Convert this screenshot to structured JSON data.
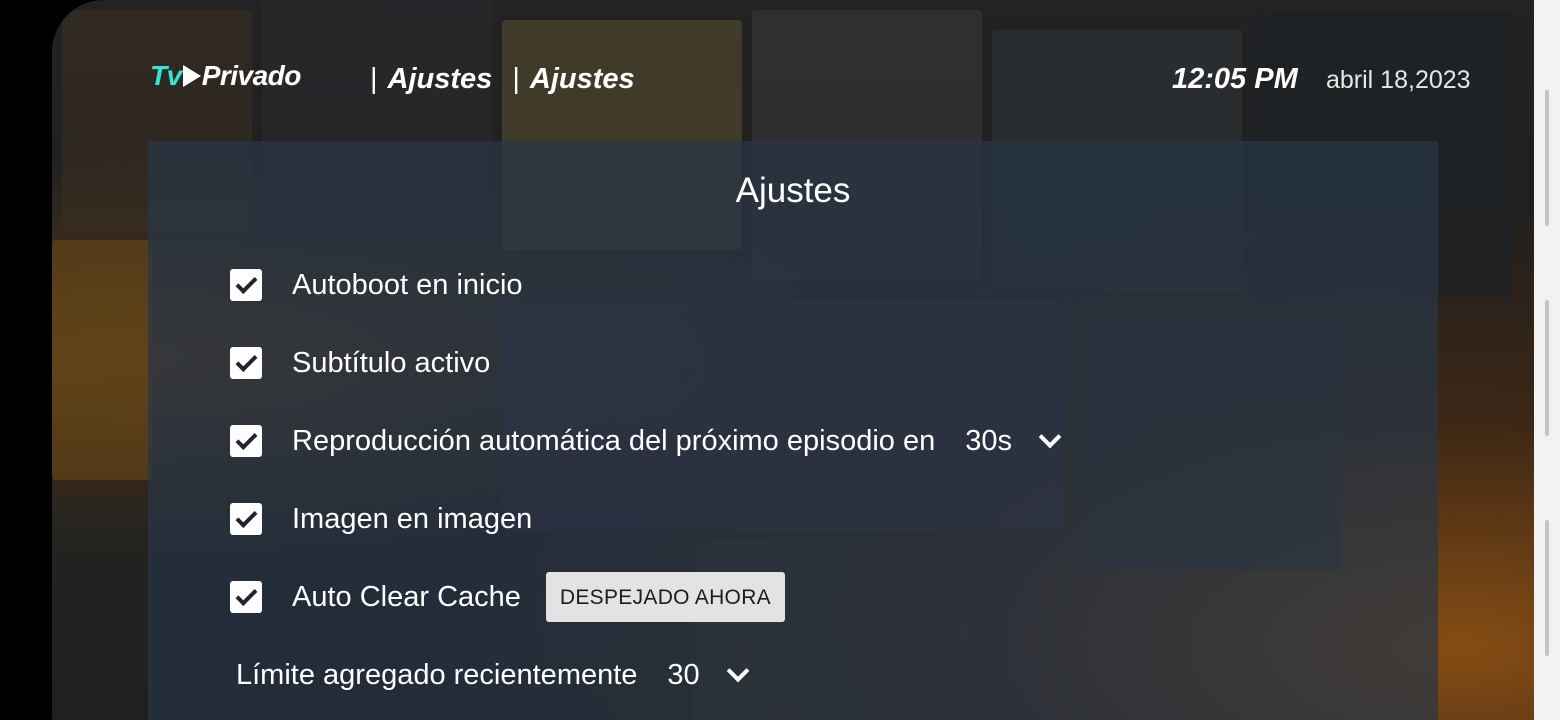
{
  "header": {
    "logo_tv": "Tv",
    "logo_privado": "Privado",
    "crumb_1": "Ajustes",
    "crumb_2": "Ajustes",
    "time": "12:05 PM",
    "date": "abril 18,2023"
  },
  "panel": {
    "title": "Ajustes",
    "options": [
      {
        "label": "Autoboot en inicio",
        "checked": true
      },
      {
        "label": "Subtítulo activo",
        "checked": true
      },
      {
        "label": "Reproducción automática del próximo episodio en",
        "checked": true,
        "value": "30s"
      },
      {
        "label": "Imagen en imagen",
        "checked": true
      },
      {
        "label": "Auto Clear Cache",
        "checked": true,
        "button": "DESPEJADO AHORA"
      }
    ],
    "limit": {
      "label": "Límite agregado recientemente",
      "value": "30"
    }
  },
  "icons": {
    "checkbox": "checkbox-checked-icon",
    "dropdown": "chevron-down-icon",
    "logo_play": "play-triangle-icon"
  },
  "colors": {
    "logo_accent": "#3ee0d6",
    "panel_bg": "#283646",
    "button_bg": "#e3e3e3"
  }
}
